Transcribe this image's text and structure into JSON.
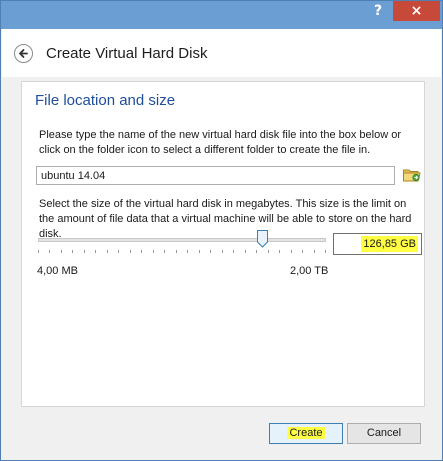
{
  "window": {
    "title_buttons": {
      "help": "?",
      "close": "×"
    }
  },
  "header": {
    "title": "Create Virtual Hard Disk"
  },
  "section": {
    "title": "File location and size",
    "file_description": "Please type the name of the new virtual hard disk file into the box below or click on the folder icon to select a different folder to create the file in.",
    "file_name": "ubuntu 14.04",
    "size_description": "Select the size of the virtual hard disk in megabytes. This size is the limit on the amount of file data that a virtual machine will be able to store on the hard disk.",
    "size_value": "126,85 GB",
    "size_min": "4,00 MB",
    "size_max": "2,00 TB",
    "slider_fraction": 0.78
  },
  "buttons": {
    "create": "Create",
    "cancel": "Cancel"
  },
  "colors": {
    "highlight": "#ffff44",
    "section_title": "#1f4e9a",
    "close": "#c7493a"
  }
}
